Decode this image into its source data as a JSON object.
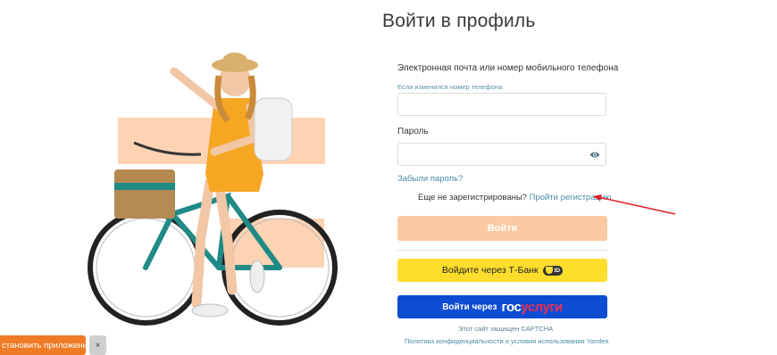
{
  "page_title": "Войти в профиль",
  "form": {
    "email_label": "Электронная почта или номер мобильного телефона",
    "email_hint": "Если изменился номер телефона",
    "email_value": "",
    "password_label": "Пароль",
    "password_value": "",
    "forgot_link": "Забыли пароль?",
    "not_registered": "Еще не зарегистрированы?",
    "register_link": "Пройти регистрацию",
    "login_button": "Войти",
    "tbank_button": "Войдите через Т-Банк",
    "tbank_badge": "ID",
    "gos_button_prefix": "Войти через",
    "gos_logo_part1": "гос",
    "gos_logo_part2": "услуги"
  },
  "footer": {
    "captcha_note": "Этот сайт защищен CAPTCHA",
    "privacy_link": "Политика конфиденциальности и условия использования Yandex"
  },
  "install_banner": {
    "label": "становить приложение",
    "close": "×"
  },
  "colors": {
    "login_button": "#fccaa2",
    "tbank": "#ffdd2d",
    "gosuslugi": "#0d4cd3",
    "install": "#ef7b27",
    "link": "#4a8aa8",
    "arrow": "#e0202a"
  },
  "icons": {
    "password_toggle": "eye-icon"
  }
}
